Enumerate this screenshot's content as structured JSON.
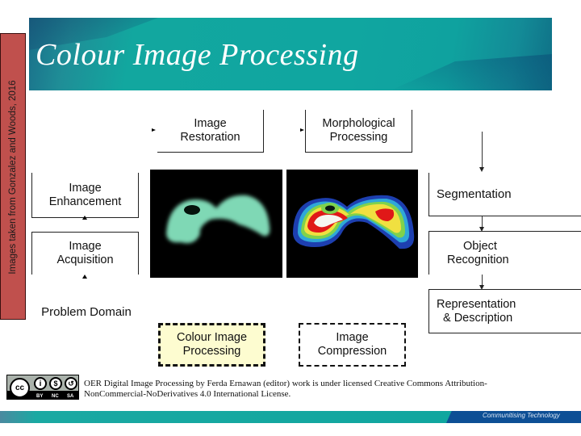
{
  "slide": {
    "title": "Colour Image Processing",
    "side_credit": "Images taken from Gonzalez and Woods, 2016"
  },
  "diagram": {
    "left_column": [
      {
        "id": "image-enhancement",
        "line1": "Image",
        "line2": "Enhancement"
      },
      {
        "id": "image-acquisition",
        "line1": "Image",
        "line2": "Acquisition"
      },
      {
        "id": "problem-domain",
        "line1": "Problem Domain",
        "line2": ""
      }
    ],
    "top_row": [
      {
        "id": "image-restoration",
        "line1": "Image",
        "line2": "Restoration"
      },
      {
        "id": "morphological-processing",
        "line1": "Morphological",
        "line2": "Processing"
      }
    ],
    "right_column": [
      {
        "id": "segmentation",
        "line1": "Segmentation",
        "line2": ""
      },
      {
        "id": "object-recognition",
        "line1": "Object",
        "line2": "Recognition"
      },
      {
        "id": "representation-description",
        "line1": "Representation",
        "line2": "& Description"
      }
    ],
    "bottom_row": [
      {
        "id": "colour-image-processing",
        "line1": "Colour Image",
        "line2": "Processing",
        "highlighted": true,
        "fill": "#fdfcd0"
      },
      {
        "id": "image-compression",
        "line1": "Image",
        "line2": "Compression",
        "highlighted": false
      }
    ],
    "photos": [
      {
        "id": "grayscale-green-tissue",
        "description": "monochrome green-tinted tissue image"
      },
      {
        "id": "pseudocolour-tissue",
        "description": "pseudo-colour version of tissue image"
      }
    ]
  },
  "footer": {
    "license_line1": "OER Digital Image Processing by Ferda Ernawan (editor) work is under licensed Creative Commons Attribution-",
    "license_line2": "NonCommercial-NoDerivatives 4.0 International License.",
    "cc_badge": {
      "cc": "cc",
      "by": "BY",
      "nc": "NC",
      "sa": "SA"
    },
    "tagline": "Communitising Technology"
  },
  "colors": {
    "banner_teal": "#10a6a0",
    "credit_red": "#c0504d",
    "footer_blue": "#0d4f95"
  }
}
